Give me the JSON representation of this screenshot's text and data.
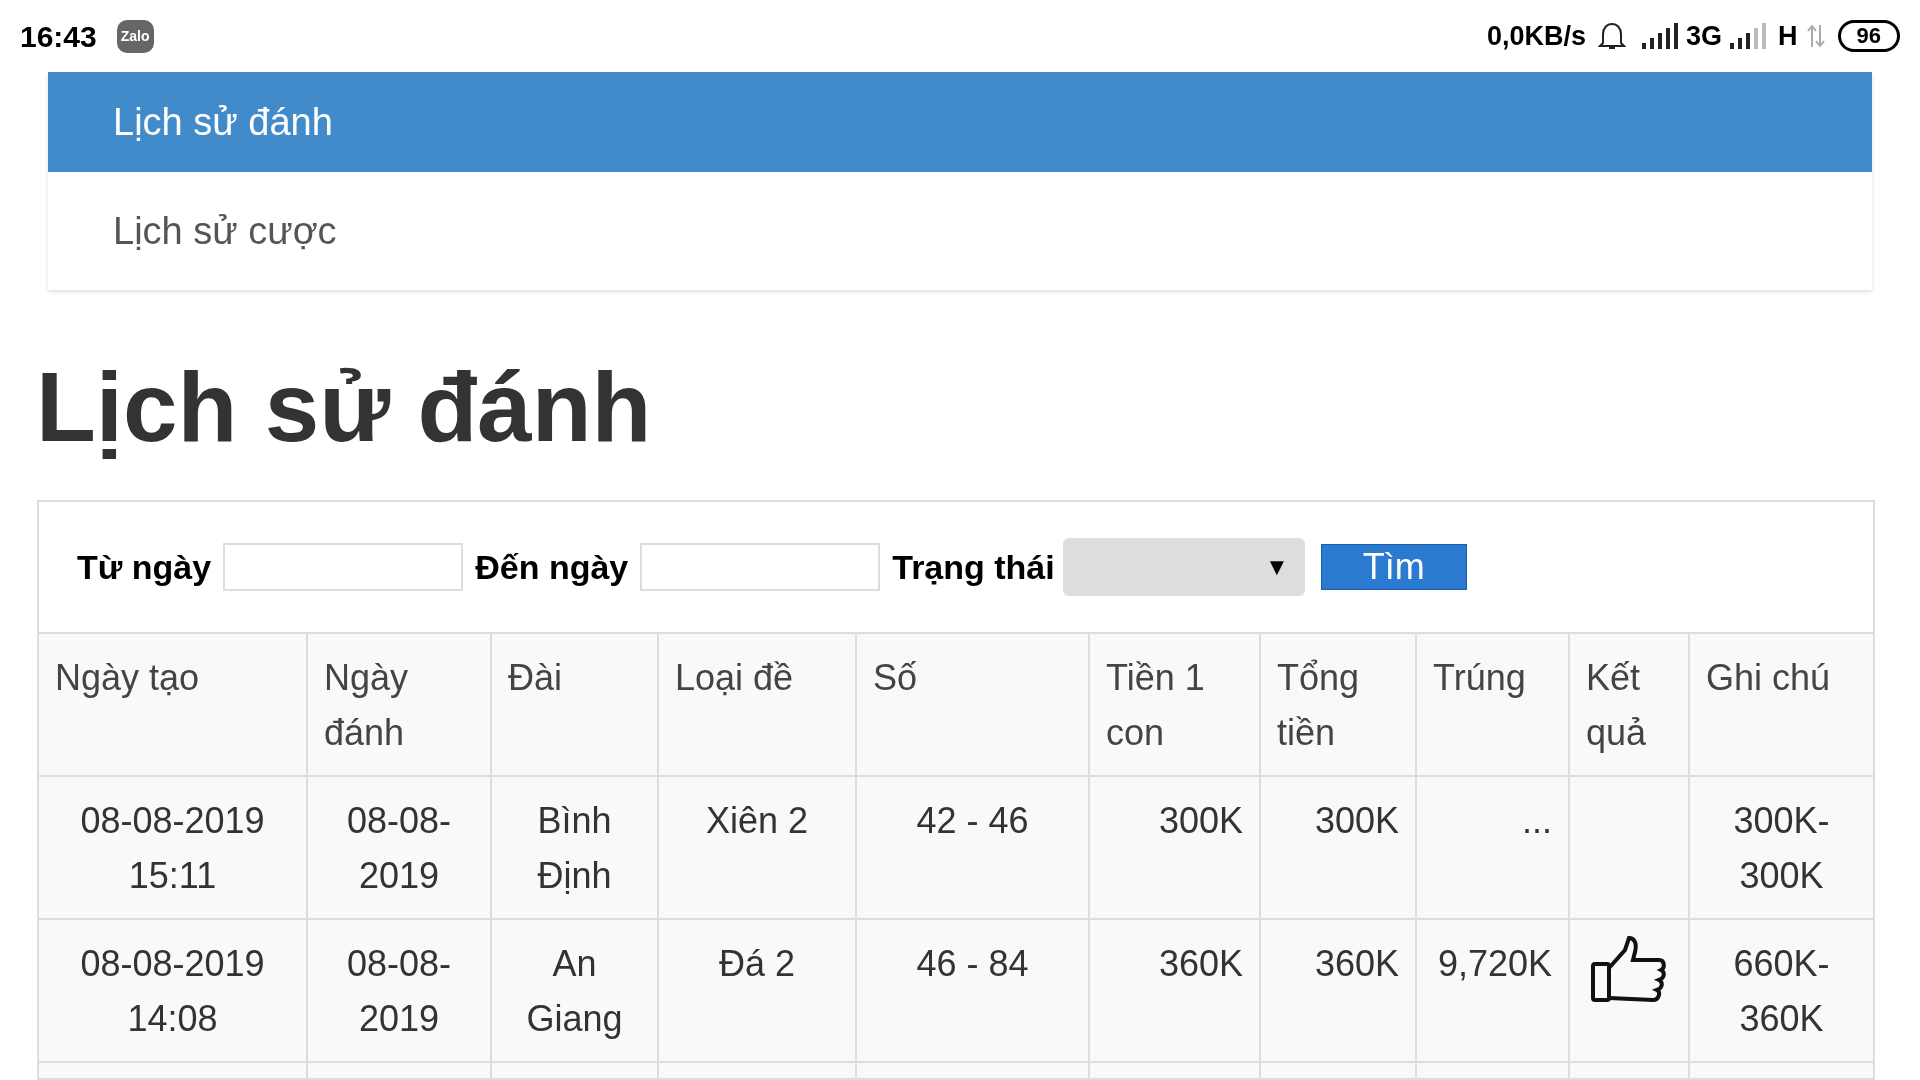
{
  "status_bar": {
    "time": "16:43",
    "app_badge": "Zalo",
    "speed": "0,0KB/s",
    "network_1": "3G",
    "network_2": "H",
    "battery": "96"
  },
  "nav": [
    {
      "label": "Lịch sử đánh",
      "selected": true
    },
    {
      "label": "Lịch sử cược",
      "selected": false
    }
  ],
  "heading": "Lịch sử đánh",
  "filter": {
    "from_label": "Từ ngày",
    "to_label": "Đến ngày",
    "status_label": "Trạng thái",
    "dropdown_arrow": "▼",
    "search_button": "Tìm"
  },
  "table": {
    "columns": [
      "Ngày tạo",
      "Ngày đánh",
      "Đài",
      "Loại đề",
      "Số",
      "Tiền 1 con",
      "Tổng tiền",
      "Trúng",
      "Kết quả",
      "Ghi chú"
    ],
    "rows": [
      {
        "cells": [
          "08-08-2019 15:11",
          "08-08-2019",
          "Bình Định",
          "Xiên 2",
          "42 - 46",
          "300K",
          "300K",
          "...",
          "",
          "300K-300K"
        ],
        "won": false
      },
      {
        "cells": [
          "08-08-2019 14:08",
          "08-08-2019",
          "An Giang",
          "Đá 2",
          "46 - 84",
          "360K",
          "360K",
          "9,720K",
          "",
          "660K-360K"
        ],
        "won": true
      }
    ]
  }
}
